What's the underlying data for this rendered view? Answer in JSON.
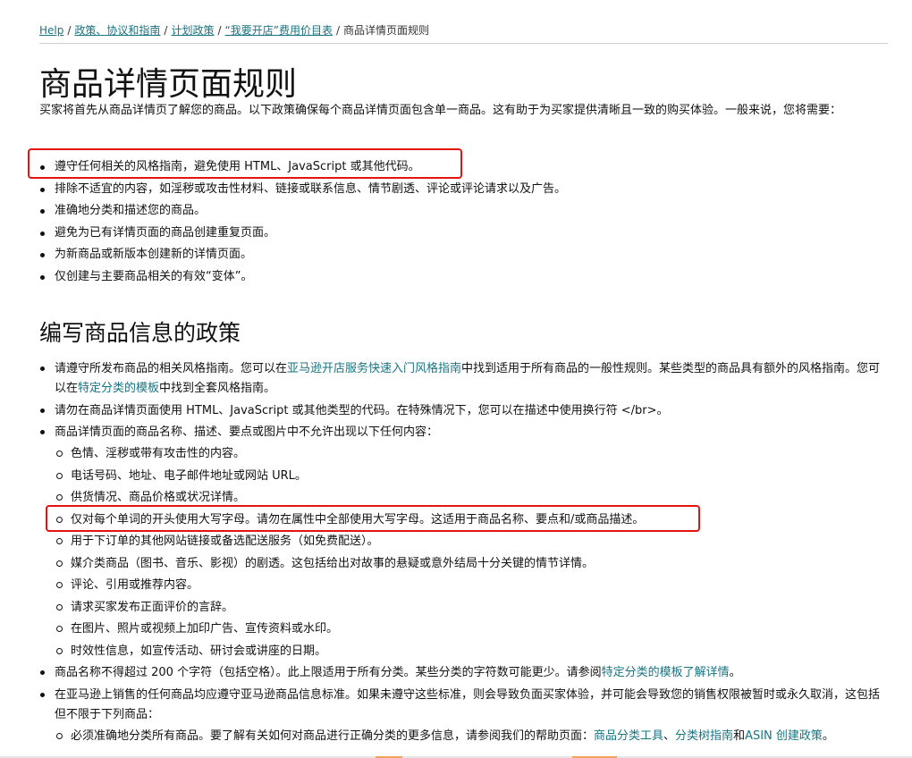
{
  "breadcrumb": {
    "items": [
      "Help",
      "政策、协议和指南",
      "计划政策",
      "“我要开店”费用价目表"
    ],
    "current": "商品详情页面规则",
    "separator": "/"
  },
  "page_title": "商品详情页面规则",
  "intro": "买家将首先从商品详情页了解您的商品。以下政策确保每个商品详情页面包含单一商品。这有助于为买家提供清晰且一致的购买体验。一般来说，您将需要：",
  "list_a": [
    "遵守任何相关的风格指南，避免使用 HTML、JavaScript 或其他代码。",
    "排除不适宜的内容，如淫秽或攻击性材料、链接或联系信息、情节剧透、评论或评论请求以及广告。",
    "准确地分类和描述您的商品。",
    "避免为已有详情页面的商品创建重复页面。",
    "为新商品或新版本创建新的详情页面。",
    "仅创建与主要商品相关的有效“变体”。"
  ],
  "section2_title": "编写商品信息的政策",
  "list_b": {
    "item1": {
      "pre": "请遵守所发布商品的相关风格指南。您可以在",
      "link1": "亚马逊开店服务快速入门风格指南",
      "mid": "中找到适用于所有商品的一般性规则。某些类型的商品具有额外的风格指南。您可以在",
      "link2": "特定分类的模板",
      "post": "中找到全套风格指南。"
    },
    "item2": "请勿在商品详情页面使用 HTML、JavaScript 或其他类型的代码。在特殊情况下，您可以在描述中使用换行符 </br>。",
    "item3": "商品详情页面的商品名称、描述、要点或图片中不允许出现以下任何内容：",
    "item3_sub": [
      "色情、淫秽或带有攻击性的内容。",
      "电话号码、地址、电子邮件地址或网站 URL。",
      "供货情况、商品价格或状况详情。",
      "仅对每个单词的开头使用大写字母。请勿在属性中全部使用大写字母。这适用于商品名称、要点和/或商品描述。",
      "用于下订单的其他网站链接或备选配送服务（如免费配送）。",
      "媒介类商品（图书、音乐、影视）的剧透。这包括给出对故事的悬疑或意外结局十分关键的情节详情。",
      "评论、引用或推荐内容。",
      "请求买家发布正面评价的言辞。",
      "在图片、照片或视频上加印广告、宣传资料或水印。",
      "时效性信息，如宣传活动、研讨会或讲座的日期。"
    ],
    "item4": {
      "pre": "商品名称不得超过 200 个字符（包括空格）。此上限适用于所有分类。某些分类的字符数可能更少。请参阅",
      "link": "特定分类的模板了解详情",
      "post": "。"
    },
    "item5": "在亚马逊上销售的任何商品均应遵守亚马逊商品信息标准。如果未遵守这些标准，则会导致负面买家体验，并可能会导致您的销售权限被暂时或永久取消，这包括但不限于下列商品：",
    "item5_sub": {
      "pre": "必须准确地分类所有商品。要了解有关如何对商品进行正确分类的更多信息，请参阅我们的帮助页面：",
      "link1": "商品分类工具",
      "sep": "、",
      "link2": "分类树指南",
      "and": "和",
      "link3": "ASIN 创建政策",
      "post": "。"
    }
  },
  "colors": {
    "link": "#1a7380",
    "highlight": "#e5120f",
    "text": "#111111",
    "rule": "#cfcfcf"
  }
}
